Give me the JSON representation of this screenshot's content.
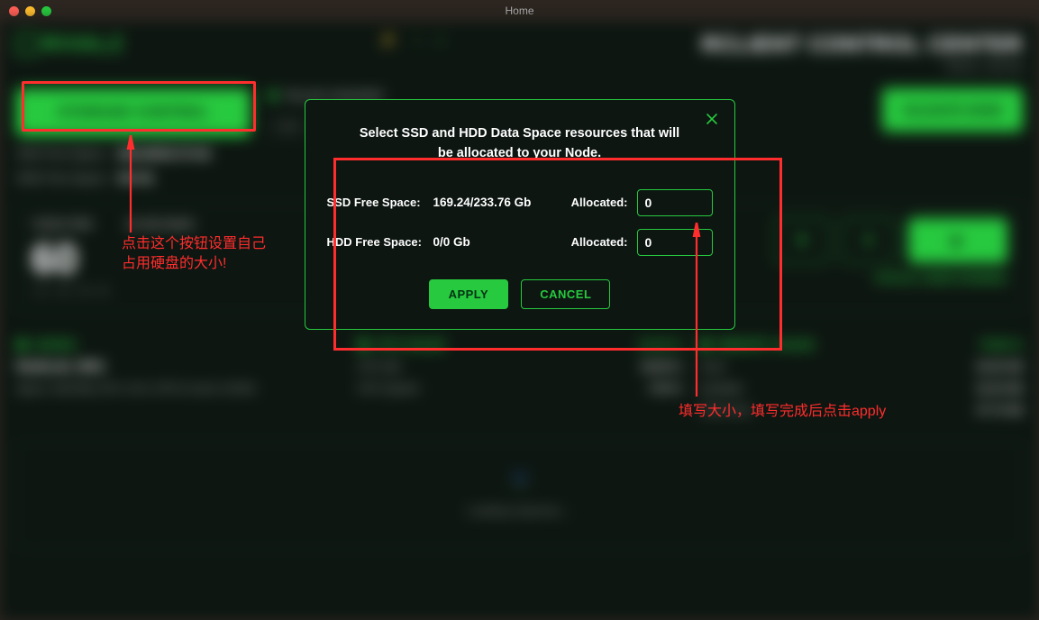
{
  "window": {
    "title": "Home"
  },
  "brand": {
    "name": "RIVALZ"
  },
  "header": {
    "title": "RCLIENT CONTROL CENTER",
    "subtitle": "Status: synced"
  },
  "storage": {
    "button_label": "STORAGE CONTROL",
    "ssd_label": "SSD Free Space:",
    "ssd_value": "169.24/233.76 Gb",
    "hdd_label": "HDD Free Space:",
    "hdd_value": "0/0 Gb"
  },
  "center": {
    "connected_text": "You are connected",
    "link_label": "LINK",
    "address": "0x",
    "validate_label": "VALIDATE NODE"
  },
  "metrics": {
    "tasks_label": "TASKS PER",
    "tasks_value": "60",
    "tasks_sub": "1 Hr · 1W · 1M · All",
    "seconds_label": "60 SECONDS"
  },
  "status": {
    "text": "STATUS: NODE RUNNING"
  },
  "cards": {
    "nodes": {
      "label": "NODES",
      "name": "NodeLab_9001",
      "spec": "Specs: Intel Mac OS X 14.5, CPU 8 cores 3.2GHz"
    },
    "cpu": {
      "label": "CPU USAGE",
      "pct": "16.30 %",
      "rows": [
        {
          "k": "CPU Idle",
          "v": "84.08 %"
        },
        {
          "k": "CPU System",
          "v": "7.50 %"
        }
      ]
    },
    "mem": {
      "label": "MEMORY USAGE",
      "pct": "78.80 %",
      "rows": [
        {
          "k": "Used",
          "v": "25.40 GB"
        },
        {
          "k": "Available",
          "v": "22.34 GB"
        },
        {
          "k": "Total Used",
          "v": "47.74 GB"
        }
      ]
    }
  },
  "loading": {
    "text": "Loading response…"
  },
  "modal": {
    "title": "Select SSD and HDD Data Space resources that will be allocated to your Node.",
    "ssd_label": "SSD Free Space:",
    "ssd_value": "169.24/233.76 Gb",
    "hdd_label": "HDD Free Space:",
    "hdd_value": "0/0 Gb",
    "alloc_label": "Allocated:",
    "ssd_alloc_value": "0",
    "hdd_alloc_value": "0",
    "apply_label": "APPLY",
    "cancel_label": "CANCEL"
  },
  "annotations": {
    "text1": "点击这个按钮设置自己<br>占用硬盘的大小!",
    "text2": "填写大小，填写完成后点击apply"
  },
  "colors": {
    "accent": "#27c93f",
    "annotation": "#ff2d2d",
    "bg_app": "#0d1611"
  }
}
